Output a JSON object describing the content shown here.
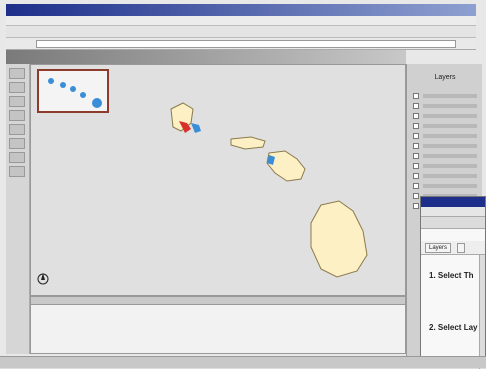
{
  "window": {
    "title": ""
  },
  "address": {
    "url": ""
  },
  "page": {
    "title": ""
  },
  "layers_panel": {
    "title": "Layers",
    "items": [
      "",
      "",
      "",
      "",
      "",
      "",
      "",
      "",
      "",
      "",
      "",
      ""
    ]
  },
  "subwindow": {
    "tabs": [
      "Layers",
      ""
    ],
    "step1": "1. Select Th",
    "step2": "2. Select Lay"
  },
  "colors": {
    "map_bg": "#e0e0e0",
    "island_fill": "#fdf0c4",
    "highlight_red": "#d8302a",
    "water_blue": "#3a8ed8",
    "overview_border": "#8c3b2c"
  }
}
